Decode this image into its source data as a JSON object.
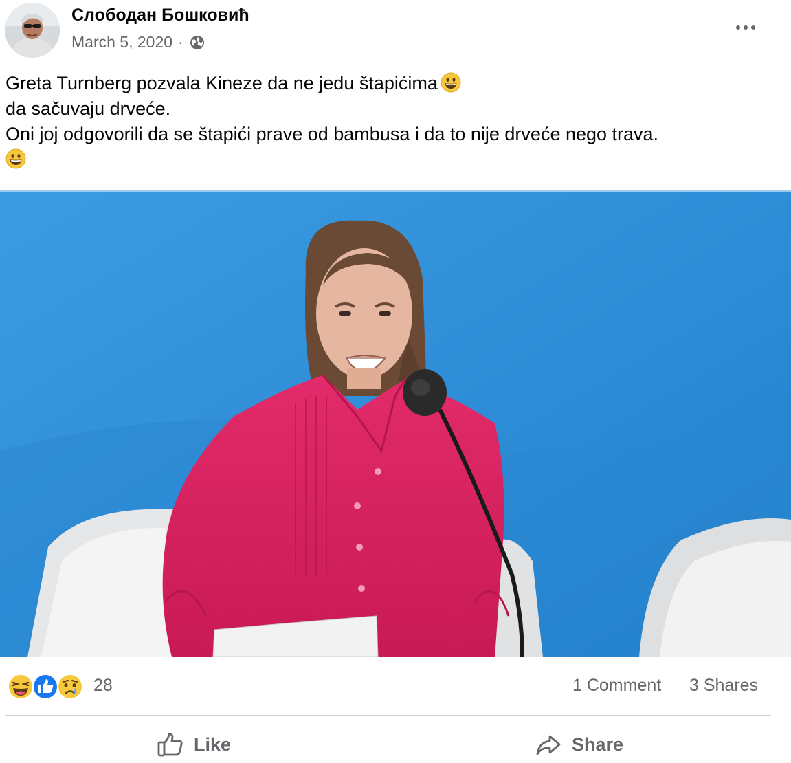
{
  "post": {
    "author_name": "Слободан Бошковић",
    "date": "March 5, 2020",
    "separator": "·",
    "privacy_icon": "globe-icon",
    "menu_icon": "more-horizontal-icon",
    "text_lines": [
      "Greta Turnberg pozvala Kineze da ne jedu štapićima",
      "da sačuvaju drveće.",
      "Oni joj odgovorili da se štapići prave od bambusa i da to nije drveće nego trava."
    ],
    "emoji": "grinning-face-emoji"
  },
  "reactions": {
    "icons": [
      "laughing-face-icon",
      "thumbs-up-icon",
      "sad-face-icon"
    ],
    "count": "28",
    "comments": "1 Comment",
    "shares": "3 Shares"
  },
  "actions": {
    "like_label": "Like",
    "share_label": "Share"
  },
  "colors": {
    "text_primary": "#050505",
    "text_secondary": "#65676b",
    "divider": "#ced0d4",
    "like_blue": "#1877f2",
    "photo_background": "#2f8fd6",
    "shirt_pink": "#d8205f"
  }
}
